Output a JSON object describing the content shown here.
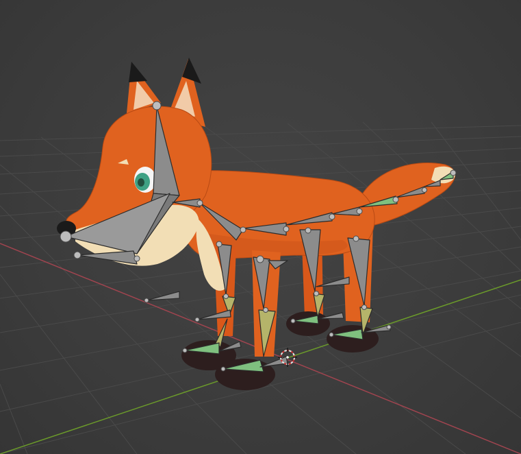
{
  "app": "3D viewport",
  "viewport": {
    "background_color": "#3d3d3d",
    "grid_color": "#4a4a4a",
    "x_axis_color": "#a0444f",
    "y_axis_color": "#6b9b2a"
  },
  "scene": {
    "object": "fox-character",
    "colors": {
      "fur_orange": "#e0621f",
      "fur_light": "#f2deb5",
      "ear_inner": "#f1cba8",
      "ear_tip": "#1a1a1a",
      "paw": "#2d1e1e",
      "eye_iris": "#3fa184",
      "bone_gray": "#8c8c8c",
      "bone_selected_green": "#7fc07f",
      "bone_olive": "#b5b46a"
    },
    "cursor_icon": "3d-cursor-icon"
  }
}
